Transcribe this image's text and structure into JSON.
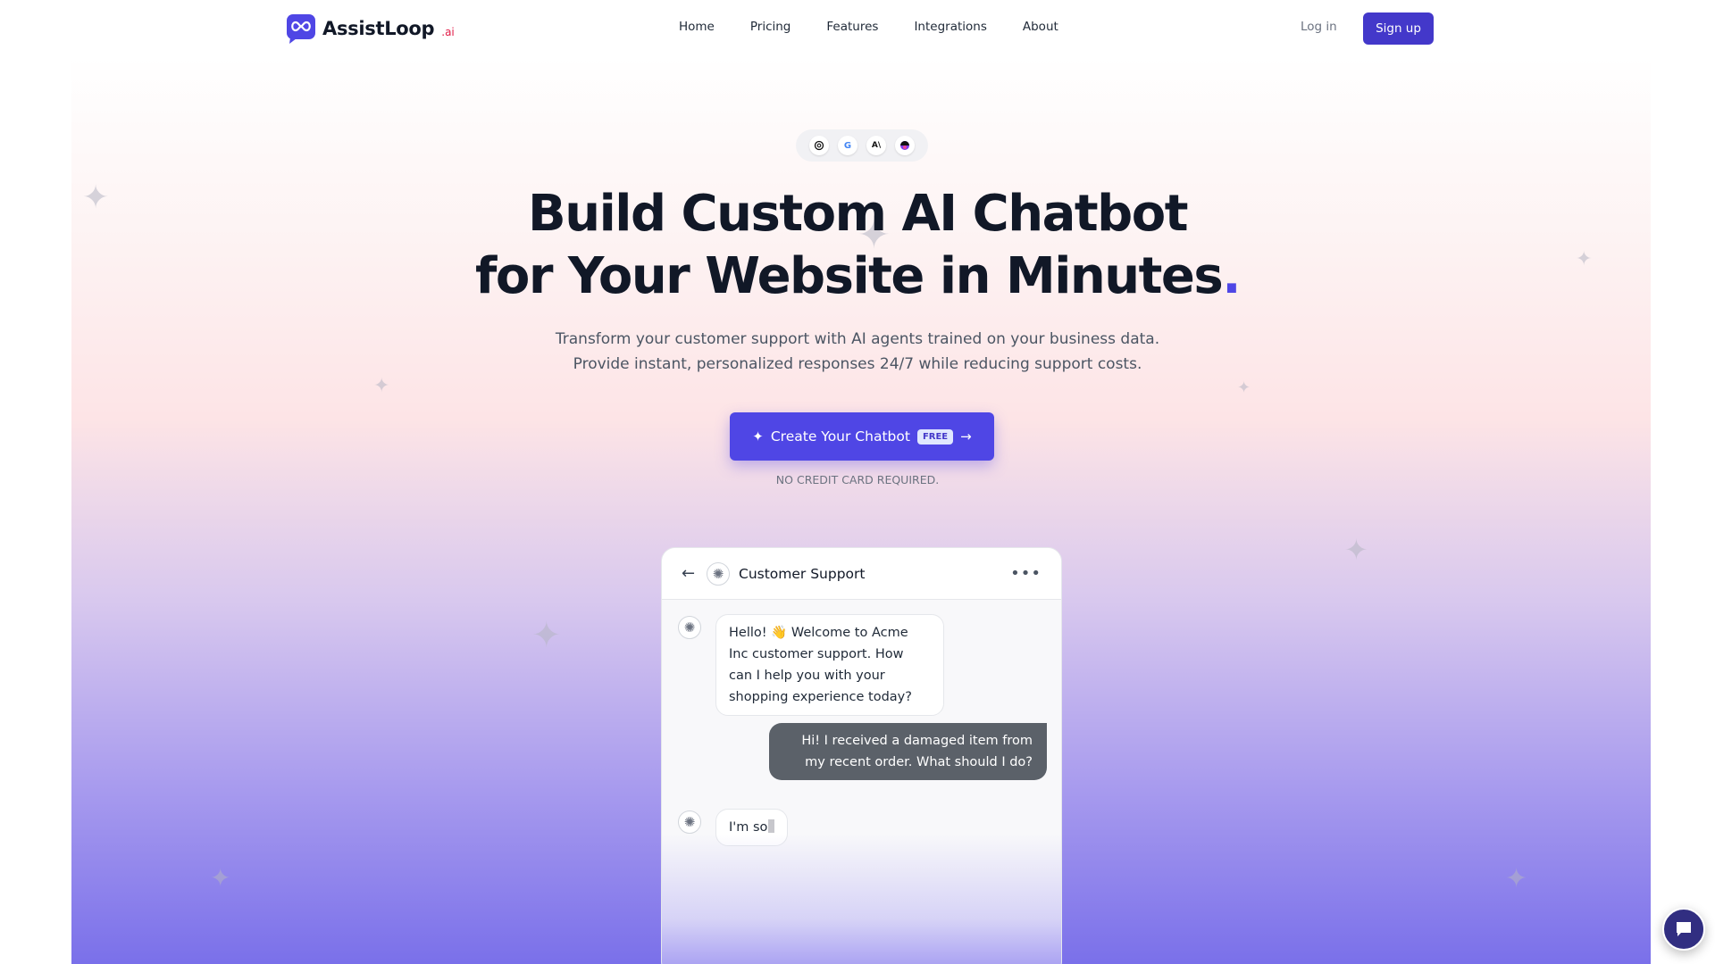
{
  "header": {
    "brand": "AssistLoop",
    "brand_suffix": ".ai",
    "nav": [
      "Home",
      "Pricing",
      "Features",
      "Integrations",
      "About"
    ],
    "login": "Log in",
    "signup": "Sign up"
  },
  "hero": {
    "model_icons": [
      "openai-icon",
      "google-icon",
      "anthropic-icon",
      "model-icon"
    ],
    "title_line1": "Build Custom AI Chatbot",
    "title_line2": "for Your Website in Minutes",
    "title_dot": ".",
    "subtitle_line1": "Transform your customer support with AI agents trained on your business data.",
    "subtitle_line2": "Provide instant, personalized responses 24/7 while reducing support costs.",
    "cta_label": "Create Your Chatbot",
    "cta_badge": "FREE",
    "note": "NO CREDIT CARD REQUIRED."
  },
  "chat": {
    "title": "Customer Support",
    "messages": [
      {
        "from": "bot",
        "text": "Hello! 👋 Welcome to Acme Inc customer support. How can I help you with your shopping experience today?"
      },
      {
        "from": "user",
        "text": "Hi! I received a damaged item from my recent order. What should I do?"
      },
      {
        "from": "bot",
        "text": "I'm so"
      }
    ]
  },
  "colors": {
    "accent": "#4f46e5",
    "signup_bg": "#4338ca",
    "user_bubble": "#5b6169",
    "brand_suffix": "#e11d48"
  }
}
